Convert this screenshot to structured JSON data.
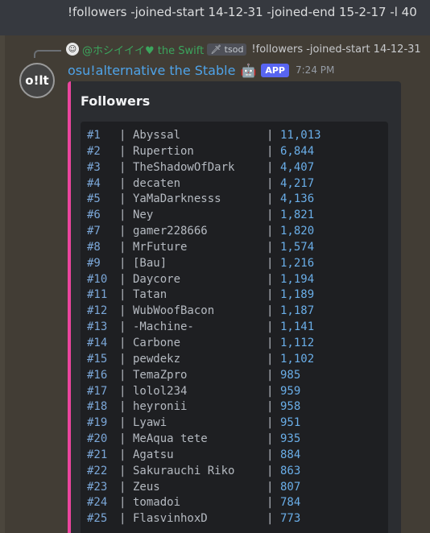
{
  "top_message": {
    "text": "!followers -joined-start 14-12-31 -joined-end 15-2-17 -l 40"
  },
  "reply": {
    "user": "@ホシイイイ♥ the Swift",
    "tag": "🗡 tsod",
    "content": "!followers -joined-start 14-12-31"
  },
  "message": {
    "avatar_text": "o!lt",
    "author": "osu!alternative the Stable",
    "author_emoji": "🤖",
    "badge": "APP",
    "timestamp": "7:24 PM"
  },
  "embed": {
    "accent_color": "#eb459e",
    "title": "Followers",
    "separator": "|",
    "rows": [
      {
        "rank": "#1",
        "name": "Abyssal",
        "count": "11,013"
      },
      {
        "rank": "#2",
        "name": "Rupertion",
        "count": "6,844"
      },
      {
        "rank": "#3",
        "name": "TheShadowOfDark",
        "count": "4,407"
      },
      {
        "rank": "#4",
        "name": "decaten",
        "count": "4,217"
      },
      {
        "rank": "#5",
        "name": "YaMaDarknesss",
        "count": "4,136"
      },
      {
        "rank": "#6",
        "name": "Ney",
        "count": "1,821"
      },
      {
        "rank": "#7",
        "name": "gamer228666",
        "count": "1,820"
      },
      {
        "rank": "#8",
        "name": "MrFuture",
        "count": "1,574"
      },
      {
        "rank": "#9",
        "name": "[Bau]",
        "count": "1,216"
      },
      {
        "rank": "#10",
        "name": "Daycore",
        "count": "1,194"
      },
      {
        "rank": "#11",
        "name": "Tatan",
        "count": "1,189"
      },
      {
        "rank": "#12",
        "name": "WubWoofBacon",
        "count": "1,187"
      },
      {
        "rank": "#13",
        "name": "-Machine-",
        "count": "1,141"
      },
      {
        "rank": "#14",
        "name": "Carbone",
        "count": "1,112"
      },
      {
        "rank": "#15",
        "name": "pewdekz",
        "count": "1,102"
      },
      {
        "rank": "#16",
        "name": "TemaZpro",
        "count": "985"
      },
      {
        "rank": "#17",
        "name": "lolol234",
        "count": "959"
      },
      {
        "rank": "#18",
        "name": "heyronii",
        "count": "958"
      },
      {
        "rank": "#19",
        "name": "Lyawi",
        "count": "951"
      },
      {
        "rank": "#20",
        "name": "MeAqua tete",
        "count": "935"
      },
      {
        "rank": "#21",
        "name": "Agatsu",
        "count": "884"
      },
      {
        "rank": "#22",
        "name": "Sakurauchi Riko",
        "count": "863"
      },
      {
        "rank": "#23",
        "name": "Zeus",
        "count": "807"
      },
      {
        "rank": "#24",
        "name": "tomadoi",
        "count": "784"
      },
      {
        "rank": "#25",
        "name": "FlasvinhoxD",
        "count": "773"
      }
    ]
  }
}
